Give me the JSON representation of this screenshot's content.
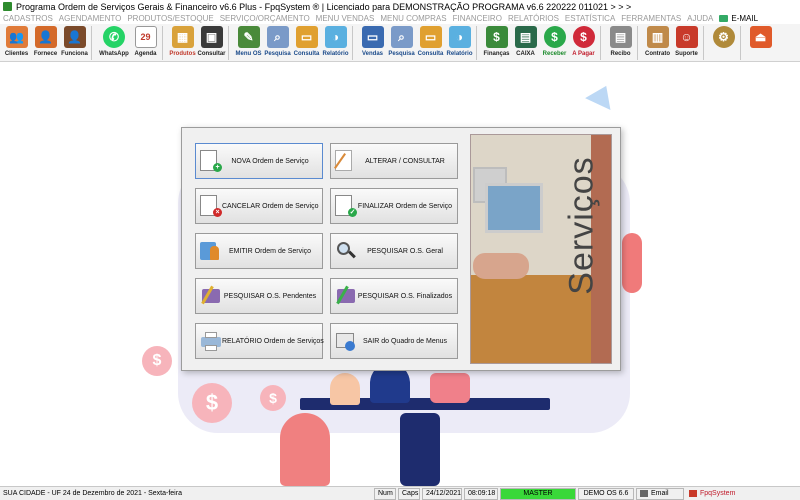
{
  "window": {
    "title": "Programa Ordem de Serviços Gerais & Financeiro v6.6 Plus - FpqSystem ® | Licenciado para  DEMONSTRAÇÃO PROGRAMA v6.6 220222 011021 > > >"
  },
  "menu": {
    "items": [
      "CADASTROS",
      "AGENDAMENTO",
      "PRODUTOS/ESTOQUE",
      "SERVIÇO/ORÇAMENTO",
      "MENU VENDAS",
      "MENU COMPRAS",
      "FINANCEIRO",
      "RELATÓRIOS",
      "ESTATÍSTICA",
      "FERRAMENTAS",
      "AJUDA"
    ],
    "email": "E-MAIL"
  },
  "toolbar": {
    "buttons": [
      {
        "label": "Clientes",
        "icon": "clients-icon",
        "color": "#e07b39"
      },
      {
        "label": "Fornece",
        "icon": "suppliers-icon",
        "color": "#d46a2a"
      },
      {
        "label": "Funciona",
        "icon": "employees-icon",
        "color": "#7b4a2a"
      },
      {
        "label": "WhatsApp",
        "icon": "whatsapp-icon",
        "color": "#25d366"
      },
      {
        "label": "Agenda",
        "icon": "calendar-icon",
        "color": "#c0392b"
      },
      {
        "label": "Produtos",
        "icon": "products-icon",
        "color": "#d9a23b"
      },
      {
        "label": "Consultar",
        "icon": "consult-icon",
        "color": "#3a3a3a"
      },
      {
        "label": "Menu OS",
        "icon": "menu-os-icon",
        "color": "#4a8a3a"
      },
      {
        "label": "Pesquisa",
        "icon": "search-icon",
        "color": "#7a9ac8"
      },
      {
        "label": "Consulta",
        "icon": "folder-icon",
        "color": "#e0a030"
      },
      {
        "label": "Relatório",
        "icon": "report-icon",
        "color": "#5ab0e0"
      },
      {
        "label": "Vendas",
        "icon": "sales-icon",
        "color": "#3a6ab0"
      },
      {
        "label": "Pesquisa",
        "icon": "search-icon",
        "color": "#7a9ac8"
      },
      {
        "label": "Consulta",
        "icon": "folder-icon",
        "color": "#e0a030"
      },
      {
        "label": "Relatório",
        "icon": "report-icon",
        "color": "#5ab0e0"
      },
      {
        "label": "Finanças",
        "icon": "finance-icon",
        "color": "#3a8a3a"
      },
      {
        "label": "CAIXA",
        "icon": "cashier-icon",
        "color": "#2a6a4a"
      },
      {
        "label": "Receber",
        "icon": "receive-icon",
        "color": "#2aa84a"
      },
      {
        "label": "A Pagar",
        "icon": "pay-icon",
        "color": "#d02a3a"
      },
      {
        "label": "Recibo",
        "icon": "receipt-icon",
        "color": "#8a8a8a"
      },
      {
        "label": "Contrato",
        "icon": "contract-icon",
        "color": "#c08a4a"
      },
      {
        "label": "Suporte",
        "icon": "support-icon",
        "color": "#c83a2a"
      },
      {
        "label": "",
        "icon": "tools-icon",
        "color": "#b08a3a"
      },
      {
        "label": "",
        "icon": "exit-icon",
        "color": "#e05a2a"
      }
    ]
  },
  "dialog": {
    "buttons": [
      {
        "label": "NOVA Ordem de Serviço",
        "icon": "new-document-icon"
      },
      {
        "label": "ALTERAR / CONSULTAR",
        "icon": "edit-pen-icon"
      },
      {
        "label": "CANCELAR Ordem de Serviço",
        "icon": "cancel-document-icon"
      },
      {
        "label": "FINALIZAR Ordem de Serviço",
        "icon": "finalize-document-icon"
      },
      {
        "label": "EMITIR Ordem de Serviço",
        "icon": "print-person-icon"
      },
      {
        "label": "PESQUISAR O.S. Geral",
        "icon": "magnifier-icon"
      },
      {
        "label": "PESQUISAR O.S. Pendentes",
        "icon": "tools-pending-icon"
      },
      {
        "label": "PESQUISAR O.S. Finalizados",
        "icon": "tools-done-icon"
      },
      {
        "label": "RELATÓRIO Ordem de Serviços",
        "icon": "printer-icon"
      },
      {
        "label": "SAIR do Quadro de Menus",
        "icon": "exit-menu-icon"
      }
    ],
    "side_title": "Serviços"
  },
  "statusbar": {
    "location": "SUA CIDADE - UF 24 de Dezembro de 2021 - Sexta-feira",
    "num": "Num",
    "caps": "Caps",
    "date": "24/12/2021",
    "time": "08:09:18",
    "master": "MASTER",
    "version": "DEMO OS 6.6",
    "email": "Email",
    "brand": "FpqSystem"
  }
}
